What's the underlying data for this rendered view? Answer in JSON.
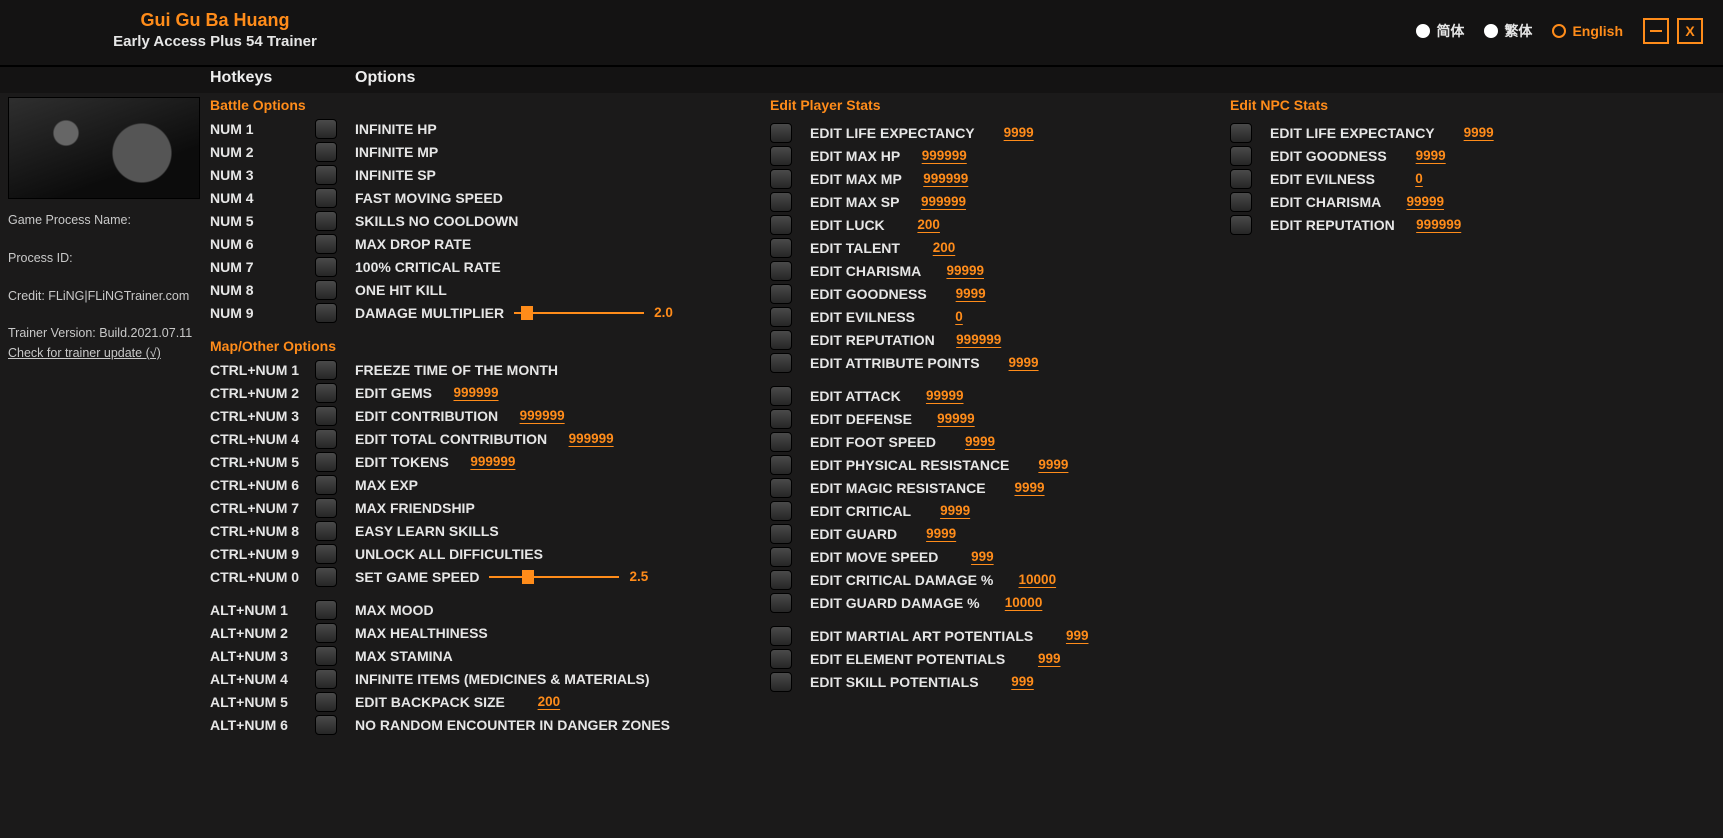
{
  "header": {
    "game_title": "Gui Gu Ba Huang",
    "subtitle": "Early Access Plus 54 Trainer",
    "lang": {
      "simplified": "简体",
      "traditional": "繁体",
      "english": "English",
      "active": "english"
    },
    "minimize_icon": "minimize",
    "close_icon": "X"
  },
  "column_headers": {
    "hotkeys": "Hotkeys",
    "options": "Options"
  },
  "sidebar": {
    "process_name_label": "Game Process Name:",
    "process_name_value": "",
    "process_id_label": "Process ID:",
    "process_id_value": "",
    "credit_label": "Credit: FLiNG|FLiNGTrainer.com",
    "version_label": "Trainer Version: Build.2021.07.11",
    "update_link": "Check for trainer update (√)"
  },
  "sections": {
    "battle": {
      "title": "Battle Options",
      "items": [
        {
          "hotkey": "NUM 1",
          "label": "INFINITE HP"
        },
        {
          "hotkey": "NUM 2",
          "label": "INFINITE MP"
        },
        {
          "hotkey": "NUM 3",
          "label": "INFINITE SP"
        },
        {
          "hotkey": "NUM 4",
          "label": "FAST MOVING SPEED"
        },
        {
          "hotkey": "NUM 5",
          "label": "SKILLS NO COOLDOWN"
        },
        {
          "hotkey": "NUM 6",
          "label": "MAX DROP RATE"
        },
        {
          "hotkey": "NUM 7",
          "label": "100% CRITICAL RATE"
        },
        {
          "hotkey": "NUM 8",
          "label": "ONE HIT KILL"
        },
        {
          "hotkey": "NUM 9",
          "label": "DAMAGE MULTIPLIER",
          "slider": true,
          "slider_thumb_pct": 5,
          "slider_value": "2.0"
        }
      ]
    },
    "mapother": {
      "title": "Map/Other Options",
      "items": [
        {
          "hotkey": "CTRL+NUM 1",
          "label": "FREEZE TIME OF THE MONTH"
        },
        {
          "hotkey": "CTRL+NUM 2",
          "label": "EDIT GEMS",
          "value": "999999"
        },
        {
          "hotkey": "CTRL+NUM 3",
          "label": "EDIT CONTRIBUTION",
          "value": "999999"
        },
        {
          "hotkey": "CTRL+NUM 4",
          "label": "EDIT TOTAL CONTRIBUTION",
          "value": "999999"
        },
        {
          "hotkey": "CTRL+NUM 5",
          "label": "EDIT TOKENS",
          "value": "999999"
        },
        {
          "hotkey": "CTRL+NUM 6",
          "label": "MAX EXP"
        },
        {
          "hotkey": "CTRL+NUM 7",
          "label": "MAX FRIENDSHIP"
        },
        {
          "hotkey": "CTRL+NUM 8",
          "label": "EASY LEARN SKILLS"
        },
        {
          "hotkey": "CTRL+NUM 9",
          "label": "UNLOCK ALL DIFFICULTIES"
        },
        {
          "hotkey": "CTRL+NUM 0",
          "label": "SET GAME SPEED",
          "slider": true,
          "slider_thumb_pct": 25,
          "slider_value": "2.5"
        }
      ],
      "items_alt": [
        {
          "hotkey": "ALT+NUM 1",
          "label": "MAX MOOD"
        },
        {
          "hotkey": "ALT+NUM 2",
          "label": "MAX HEALTHINESS"
        },
        {
          "hotkey": "ALT+NUM 3",
          "label": "MAX STAMINA"
        },
        {
          "hotkey": "ALT+NUM 4",
          "label": "INFINITE ITEMS (MEDICINES & MATERIALS)"
        },
        {
          "hotkey": "ALT+NUM 5",
          "label": "EDIT BACKPACK SIZE",
          "value": "200"
        },
        {
          "hotkey": "ALT+NUM 6",
          "label": "NO RANDOM ENCOUNTER IN DANGER ZONES"
        }
      ]
    },
    "player": {
      "title": "Edit Player Stats",
      "group1": [
        {
          "label": "EDIT LIFE EXPECTANCY",
          "value": "9999"
        },
        {
          "label": "EDIT MAX HP",
          "value": "999999"
        },
        {
          "label": "EDIT MAX MP",
          "value": "999999"
        },
        {
          "label": "EDIT MAX SP",
          "value": "999999"
        },
        {
          "label": "EDIT LUCK",
          "value": "200"
        },
        {
          "label": "EDIT TALENT",
          "value": "200"
        },
        {
          "label": "EDIT CHARISMA",
          "value": "99999"
        },
        {
          "label": "EDIT GOODNESS",
          "value": "9999"
        },
        {
          "label": "EDIT EVILNESS",
          "value": "0"
        },
        {
          "label": "EDIT REPUTATION",
          "value": "999999"
        },
        {
          "label": "EDIT ATTRIBUTE POINTS",
          "value": "9999"
        }
      ],
      "group2": [
        {
          "label": "EDIT ATTACK",
          "value": "99999"
        },
        {
          "label": "EDIT DEFENSE",
          "value": "99999"
        },
        {
          "label": "EDIT FOOT SPEED",
          "value": "9999"
        },
        {
          "label": "EDIT PHYSICAL RESISTANCE",
          "value": "9999"
        },
        {
          "label": "EDIT MAGIC RESISTANCE",
          "value": "9999"
        },
        {
          "label": "EDIT CRITICAL",
          "value": "9999"
        },
        {
          "label": "EDIT GUARD",
          "value": "9999"
        },
        {
          "label": "EDIT MOVE SPEED",
          "value": "999"
        },
        {
          "label": "EDIT CRITICAL DAMAGE %",
          "value": "10000"
        },
        {
          "label": "EDIT GUARD DAMAGE %",
          "value": "10000"
        }
      ],
      "group3": [
        {
          "label": "EDIT MARTIAL ART POTENTIALS",
          "value": "999"
        },
        {
          "label": "EDIT ELEMENT POTENTIALS",
          "value": "999"
        },
        {
          "label": "EDIT SKILL POTENTIALS",
          "value": "999"
        }
      ]
    },
    "npc": {
      "title": "Edit NPC Stats",
      "items": [
        {
          "label": "EDIT LIFE EXPECTANCY",
          "value": "9999"
        },
        {
          "label": "EDIT GOODNESS",
          "value": "9999"
        },
        {
          "label": "EDIT EVILNESS",
          "value": "0"
        },
        {
          "label": "EDIT CHARISMA",
          "value": "99999"
        },
        {
          "label": "EDIT REPUTATION",
          "value": "999999"
        }
      ]
    }
  }
}
